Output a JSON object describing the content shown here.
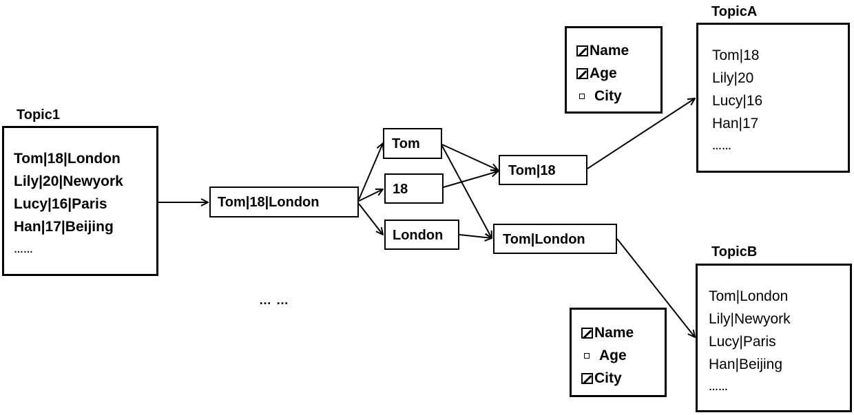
{
  "topic1": {
    "title": "Topic1",
    "rows": [
      "Tom|18|London",
      "Lily|20|Newyork",
      "Lucy|16|Paris",
      "Han|17|Beijing",
      "……"
    ]
  },
  "message_node": {
    "label": "Tom|18|London"
  },
  "field_nodes": {
    "name": "Tom",
    "age": "18",
    "city": "London"
  },
  "combined_nodes": {
    "name_age": "Tom|18",
    "name_city": "Tom|London"
  },
  "ellipsis": "… …",
  "filter_a": {
    "fields": [
      {
        "label": "Name",
        "checked": true
      },
      {
        "label": "Age",
        "checked": true
      },
      {
        "label": "City",
        "checked": false
      }
    ]
  },
  "filter_b": {
    "fields": [
      {
        "label": "Name",
        "checked": true
      },
      {
        "label": "Age",
        "checked": false
      },
      {
        "label": "City",
        "checked": true
      }
    ]
  },
  "topicA": {
    "title": "TopicA",
    "rows": [
      "Tom|18",
      "Lily|20",
      "Lucy|16",
      "Han|17",
      "……"
    ]
  },
  "topicB": {
    "title": "TopicB",
    "rows": [
      "Tom|London",
      "Lily|Newyork",
      "Lucy|Paris",
      "Han|Beijing",
      "……"
    ]
  }
}
